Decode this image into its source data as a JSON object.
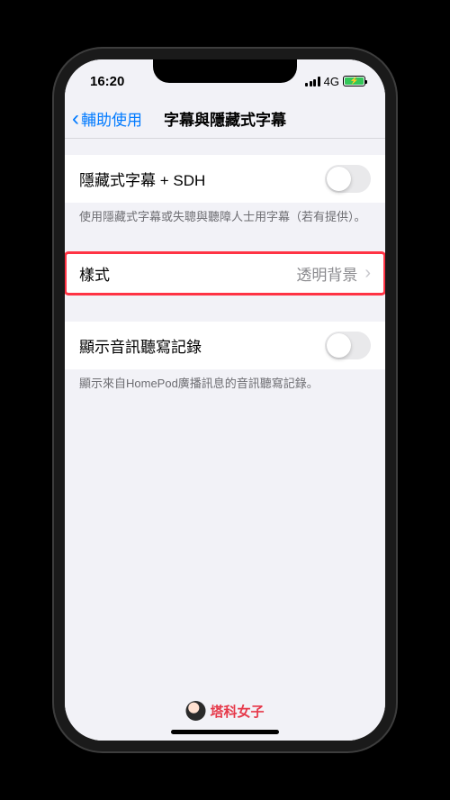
{
  "statusBar": {
    "time": "16:20",
    "network": "4G"
  },
  "nav": {
    "back": "輔助使用",
    "title": "字幕與隱藏式字幕"
  },
  "groups": {
    "sdh": {
      "label": "隱藏式字幕 + SDH",
      "footer": "使用隱藏式字幕或失聰與聽障人士用字幕（若有提供）。"
    },
    "style": {
      "label": "樣式",
      "value": "透明背景"
    },
    "transcript": {
      "label": "顯示音訊聽寫記錄",
      "footer": "顯示來自HomePod廣播訊息的音訊聽寫記錄。"
    }
  },
  "watermark": "塔科女子"
}
